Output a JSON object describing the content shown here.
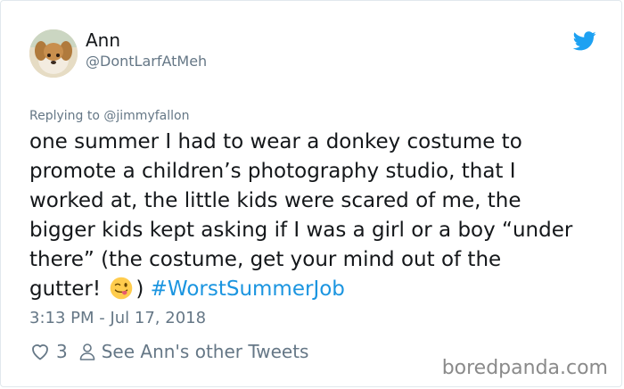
{
  "author": {
    "name": "Ann",
    "handle": "@DontLarfAtMeh"
  },
  "icons": {
    "brand": "twitter-bird-icon",
    "like": "heart-icon",
    "profile": "person-icon",
    "emoji": "winking-tongue-emoji-icon"
  },
  "colors": {
    "twitter_blue": "#1da1f2",
    "hashtag": "#1b95e0",
    "secondary_text": "#657786"
  },
  "reply": {
    "prefix": "Replying to",
    "mention": "@jimmyfallon"
  },
  "tweet": {
    "lines": [
      "one summer I had to wear a donkey costume to",
      "promote a children’s photography studio, that I",
      "worked at, the little kids were scared of me, the",
      "bigger kids kept asking if I was a girl or a boy “under",
      "there” (the costume, get your mind out of the"
    ],
    "last_line_before_emoji": "gutter!",
    "last_line_after_emoji": ")",
    "hashtag": "#WorstSummerJob",
    "timestamp": "3:13 PM - Jul 17, 2018"
  },
  "actions": {
    "like_count": "3",
    "other_tweets_label": "See Ann's other Tweets"
  },
  "watermark": "boredpanda.com"
}
